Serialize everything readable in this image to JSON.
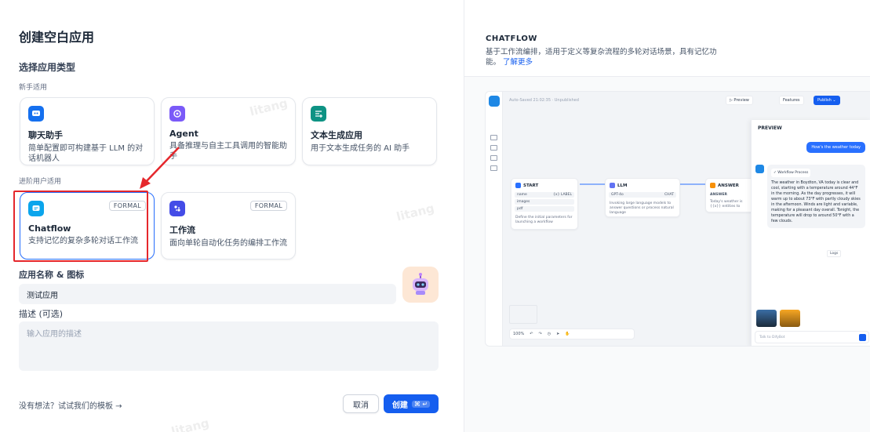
{
  "dialog": {
    "title": "创建空白应用",
    "section_app_type": "选择应用类型",
    "beginner_label": "新手适用",
    "advanced_label": "进阶用户适用",
    "cards_beginner": [
      {
        "title": "聊天助手",
        "desc": "简单配置即可构建基于 LLM 的对话机器人",
        "icon": "chat-bot-icon",
        "color": "#1570ef"
      },
      {
        "title": "Agent",
        "desc": "具备推理与自主工具调用的智能助手",
        "icon": "agent-icon",
        "color": "#7a5af8"
      },
      {
        "title": "文本生成应用",
        "desc": "用于文本生成任务的 AI 助手",
        "icon": "text-generation-icon",
        "color": "#0e9384"
      }
    ],
    "cards_advanced": [
      {
        "title": "Chatflow",
        "desc": "支持记忆的复杂多轮对话工作流",
        "badge": "FORMAL",
        "icon": "chatflow-icon",
        "color": "#0ba5ec"
      },
      {
        "title": "工作流",
        "desc": "面向单轮自动化任务的编排工作流",
        "badge": "FORMAL",
        "icon": "workflow-icon",
        "color": "#444ce7"
      }
    ],
    "name_label": "应用名称 & 图标",
    "name_value": "测试应用",
    "desc_label": "描述 (可选)",
    "desc_placeholder": "输入应用的描述",
    "footer_link": "没有想法？试试我们的模板 →",
    "cancel_label": "取消",
    "create_label": "创建",
    "create_shortcut": "⌘ ↵",
    "selected_color": "#2970ff",
    "highlight_color": "#e5272c"
  },
  "watermark": "litang",
  "preview_panel": {
    "title": "CHATFLOW",
    "desc": "基于工作流编排，适用于定义等复杂流程的多轮对话场景，具有记忆功能。",
    "learn_more": "了解更多",
    "screenshot": {
      "autosaved": "Auto-Saved 21:02:35 · Unpublished",
      "preview_btn": "▷ Preview",
      "features_btn": "Features",
      "publish_btn": "Publish ⌄",
      "nodes": {
        "start": {
          "title": "START",
          "rows": [
            [
              "name",
              "{x} LABEL"
            ],
            [
              "images",
              ""
            ],
            [
              "pdf",
              ""
            ]
          ],
          "desc": "Define the initial parameters for launching a workflow"
        },
        "llm": {
          "title": "LLM",
          "model": "GPT-4o",
          "tag": "CHAT",
          "desc": "Invoking large language models to answer questions or process natural language"
        },
        "answer": {
          "title": "ANSWER",
          "label": "ANSWER",
          "text": "Today's weather is {{x}} entities to answer."
        }
      },
      "zoom": "100%",
      "preview_title": "PREVIEW",
      "user_msg": "How's the weather today",
      "workflow_process": "Workflow Process",
      "bot_msg": "The weather in Boydton, VA today is clear and cool, starting with a temperature around 44°F in the morning. As the day progresses, it will warm up to about 73°F with partly cloudy skies in the afternoon. Winds are light and variable, making for a pleasant day overall. Tonight, the temperature will drop to around 50°F with a few clouds.",
      "logs": "Logs",
      "input_placeholder": "Talk to DifyBot"
    }
  }
}
